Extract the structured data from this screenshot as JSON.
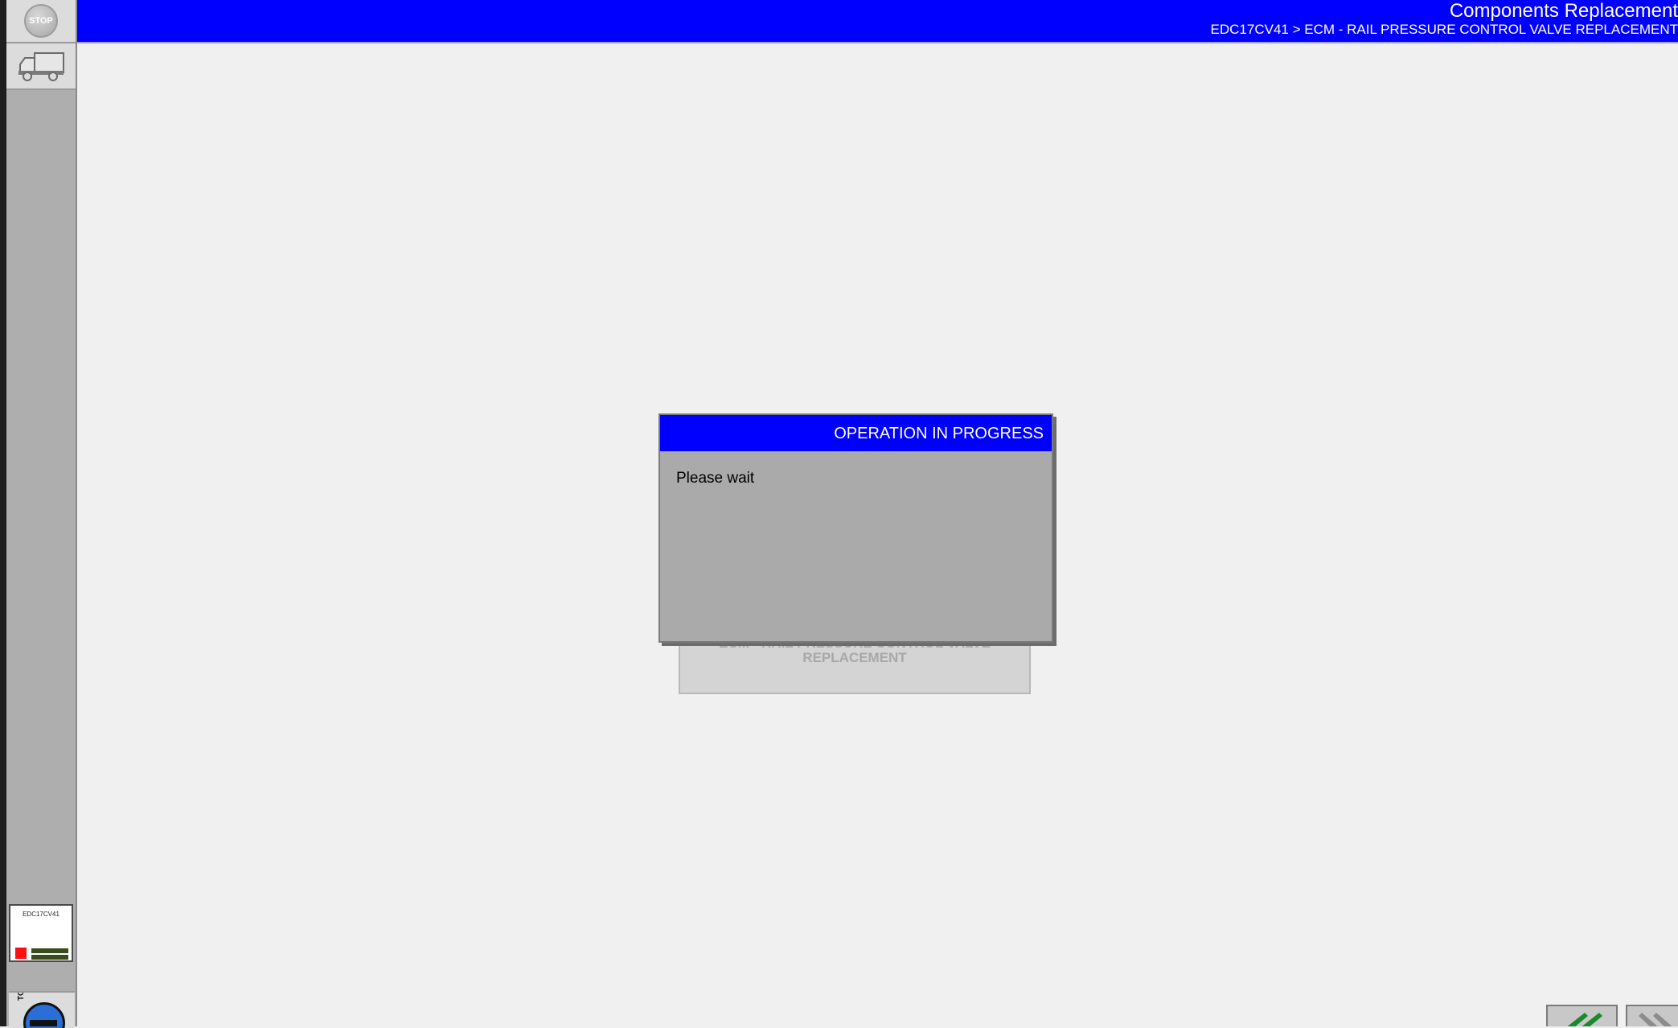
{
  "header": {
    "title": "Components Replacement",
    "breadcrumb": "EDC17CV41 > ECM - RAIL PRESSURE CONTROL VALVE REPLACEMENT"
  },
  "sidebar": {
    "stop_label": "STOP",
    "stop_icon": "stop-icon",
    "vehicle_icon": "truck-icon",
    "ecu_label": "EDC17CV41",
    "ecu_status_color": "#ff1010",
    "bottom_tool_label": "TOP"
  },
  "background_card": {
    "line1": "ECM - RAIL PRESSURE CONTROL VALVE",
    "line2": "REPLACEMENT"
  },
  "dialog": {
    "title": "OPERATION IN PROGRESS",
    "message": "Please wait"
  },
  "footer": {
    "back_icon": "double-chevron-left-icon",
    "forward_icon": "double-chevron-right-icon"
  },
  "colors": {
    "accent": "#0000ff",
    "background": "#f0f0f0",
    "dialog_body": "#aaaaaa"
  }
}
